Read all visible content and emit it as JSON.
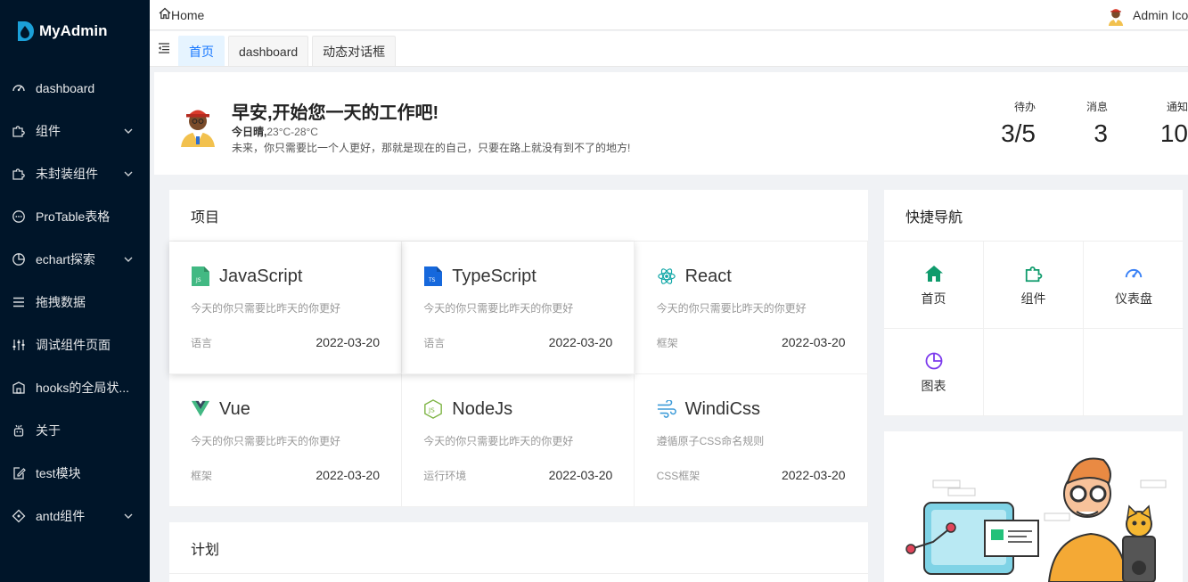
{
  "app": {
    "name": "MyAdmin"
  },
  "sidebar": {
    "items": [
      {
        "label": "dashboard",
        "icon": "dashboard-icon",
        "has_children": false
      },
      {
        "label": "组件",
        "icon": "puzzle-icon",
        "has_children": true
      },
      {
        "label": "未封装组件",
        "icon": "puzzle-icon",
        "has_children": true
      },
      {
        "label": "ProTable表格",
        "icon": "message-icon",
        "has_children": false
      },
      {
        "label": "echart探索",
        "icon": "pie-chart-icon",
        "has_children": true
      },
      {
        "label": "拖拽数据",
        "icon": "menu-lines-icon",
        "has_children": false
      },
      {
        "label": "调试组件页面",
        "icon": "sliders-icon",
        "has_children": false
      },
      {
        "label": "hooks的全局状...",
        "icon": "building-icon",
        "has_children": false
      },
      {
        "label": "关于",
        "icon": "robot-icon",
        "has_children": false
      },
      {
        "label": "test模块",
        "icon": "edit-icon",
        "has_children": false
      },
      {
        "label": "antd组件",
        "icon": "diamond-icon",
        "has_children": true
      }
    ]
  },
  "header": {
    "breadcrumb": "Home",
    "user_name": "Admin Icon"
  },
  "tabs": [
    {
      "label": "首页",
      "active": true
    },
    {
      "label": "dashboard",
      "active": false
    },
    {
      "label": "动态对话框",
      "active": false
    }
  ],
  "greeting": {
    "title": "早安,开始您一天的工作吧!",
    "weather_prefix": "今日晴,",
    "weather_temp": "23°C-28°C",
    "motto": "未来，你只需要比一个人更好，那就是现在的自己，只要在路上就没有到不了的地方!",
    "stats": [
      {
        "label": "待办",
        "value": "3/5"
      },
      {
        "label": "消息",
        "value": "3"
      },
      {
        "label": "通知",
        "value": "10"
      }
    ]
  },
  "projects": {
    "title": "项目",
    "items": [
      {
        "name": "JavaScript",
        "desc": "今天的你只需要比昨天的你更好",
        "tag": "语言",
        "date": "2022-03-20",
        "icon": "javascript-icon",
        "color": "#42b983"
      },
      {
        "name": "TypeScript",
        "desc": "今天的你只需要比昨天的你更好",
        "tag": "语言",
        "date": "2022-03-20",
        "icon": "typescript-icon",
        "color": "#1668dc"
      },
      {
        "name": "React",
        "desc": "今天的你只需要比昨天的你更好",
        "tag": "框架",
        "date": "2022-03-20",
        "icon": "react-icon",
        "color": "#13a8a8"
      },
      {
        "name": "Vue",
        "desc": "今天的你只需要比昨天的你更好",
        "tag": "框架",
        "date": "2022-03-20",
        "icon": "vue-icon",
        "color": "#42b883"
      },
      {
        "name": "NodeJs",
        "desc": "今天的你只需要比昨天的你更好",
        "tag": "运行环境",
        "date": "2022-03-20",
        "icon": "nodejs-icon",
        "color": "#7cb342"
      },
      {
        "name": "WindiCss",
        "desc": "遵循原子CSS命名规则",
        "tag": "CSS框架",
        "date": "2022-03-20",
        "icon": "windicss-icon",
        "color": "#3d9bd8"
      }
    ]
  },
  "plan": {
    "title": "计划"
  },
  "quicknav": {
    "title": "快捷导航",
    "items": [
      {
        "label": "首页",
        "icon": "home-icon",
        "color": "#0f9b6c"
      },
      {
        "label": "组件",
        "icon": "puzzle-icon",
        "color": "#0f9b6c"
      },
      {
        "label": "仪表盘",
        "icon": "dashboard-icon",
        "color": "#3b82f6"
      },
      {
        "label": "图表",
        "icon": "pie-chart-icon",
        "color": "#7c3aed"
      }
    ]
  }
}
